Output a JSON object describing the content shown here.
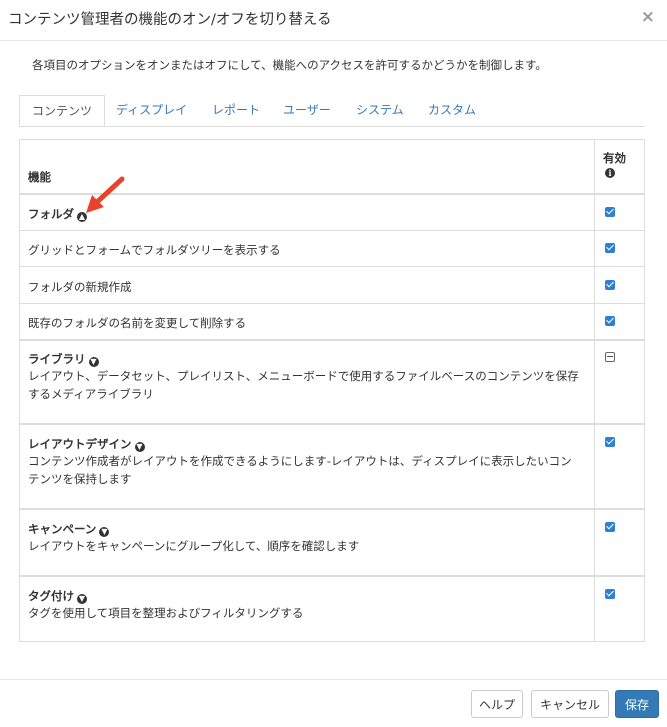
{
  "dialog": {
    "title": "コンテンツ管理者の機能のオン/オフを切り替える",
    "close_symbol": "×",
    "description": "各項目のオプションをオンまたはオフにして、機能へのアクセスを許可するかどうかを制御します。"
  },
  "tabs": [
    {
      "label": "コンテンツ",
      "active": true
    },
    {
      "label": "ディスプレイ"
    },
    {
      "label": "レポート"
    },
    {
      "label": "ユーザー"
    },
    {
      "label": "システム"
    },
    {
      "label": "カスタム"
    }
  ],
  "table": {
    "header_feature": "機能",
    "header_enabled": "有効",
    "info_symbol": "i",
    "rows": [
      {
        "type": "group",
        "title": "フォルダ",
        "toggle_icon": "chevron-up-circle-icon",
        "state": "checked"
      },
      {
        "type": "item",
        "label": "グリッドとフォームでフォルダツリーを表示する",
        "state": "checked"
      },
      {
        "type": "item",
        "label": "フォルダの新規作成",
        "state": "checked"
      },
      {
        "type": "item",
        "label": "既存のフォルダの名前を変更して削除する",
        "state": "checked"
      },
      {
        "type": "group",
        "title": "ライブラリ",
        "toggle_icon": "chevron-down-circle-icon",
        "description": "レイアウト、データセット、プレイリスト、メニューボードで使用するファイルベースのコンテンツを保存するメディアライブラリ",
        "state": "indeterminate"
      },
      {
        "type": "group",
        "title": "レイアウトデザイン",
        "toggle_icon": "chevron-down-circle-icon",
        "description": "コンテンツ作成者がレイアウトを作成できるようにします-レイアウトは、ディスプレイに表示したいコンテンツを保持します",
        "state": "checked"
      },
      {
        "type": "group",
        "title": "キャンペーン",
        "toggle_icon": "chevron-down-circle-icon",
        "description": "レイアウトをキャンペーンにグループ化して、順序を確認します",
        "state": "checked"
      },
      {
        "type": "group",
        "title": "タグ付け",
        "toggle_icon": "chevron-down-circle-icon",
        "description": "タグを使用して項目を整理およびフィルタリングする",
        "state": "checked"
      }
    ]
  },
  "footer": {
    "help_label": "ヘルプ",
    "cancel_label": "キャンセル",
    "save_label": "保存"
  },
  "colors": {
    "accent": "#337ab7",
    "checkbox": "#2f7fd6",
    "annotation_arrow": "#e8412c"
  },
  "annotation": {
    "icon": "red-arrow-icon"
  }
}
